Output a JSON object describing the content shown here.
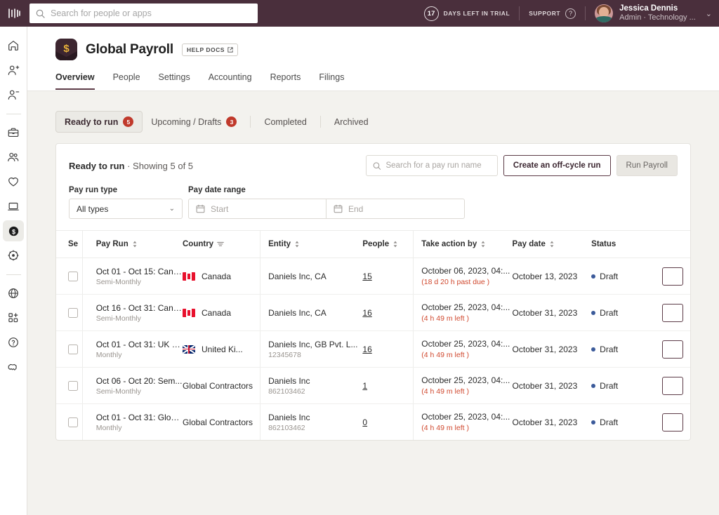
{
  "topbar": {
    "logo_name": "rippling-logo",
    "search": {
      "placeholder": "Search for people or apps",
      "value": ""
    },
    "trial_days": "17",
    "trial_label": "DAYS LEFT IN TRIAL",
    "support_label": "SUPPORT",
    "help_icon": "?",
    "user_name": "Jessica Dennis",
    "user_role": "Admin · Technology ...",
    "caret": "⌄"
  },
  "rail": {
    "items": [
      {
        "icon": "home-icon",
        "active": false
      },
      {
        "icon": "user-add-icon",
        "active": false
      },
      {
        "icon": "user-remove-icon",
        "active": false
      },
      {
        "icon": "briefcase-icon",
        "active": false
      },
      {
        "icon": "people-icon",
        "active": false
      },
      {
        "icon": "heart-icon",
        "active": false
      },
      {
        "icon": "laptop-icon",
        "active": false
      },
      {
        "icon": "dollar-circle-icon",
        "active": true
      },
      {
        "icon": "gear-icon",
        "active": false
      },
      {
        "icon": "globe-icon",
        "active": false
      },
      {
        "icon": "apps-add-icon",
        "active": false
      },
      {
        "icon": "question-circle-icon",
        "active": false
      },
      {
        "icon": "handshake-icon",
        "active": false
      }
    ]
  },
  "page": {
    "app_icon": "payroll-dollar-icon",
    "title": "Global Payroll",
    "help_docs_label": "HELP DOCS",
    "help_docs_icon": "external-link-icon",
    "nav_tabs": [
      {
        "label": "Overview",
        "active": true
      },
      {
        "label": "People",
        "active": false
      },
      {
        "label": "Settings",
        "active": false
      },
      {
        "label": "Accounting",
        "active": false
      },
      {
        "label": "Reports",
        "active": false
      },
      {
        "label": "Filings",
        "active": false
      }
    ]
  },
  "status_tabs": [
    {
      "label": "Ready to run",
      "badge": "5",
      "selected": true
    },
    {
      "label": "Upcoming / Drafts",
      "badge": "3",
      "selected": false
    },
    {
      "label": "Completed",
      "badge": "",
      "selected": false
    },
    {
      "label": "Archived",
      "badge": "",
      "selected": false
    }
  ],
  "card": {
    "title_bold": "Ready to run",
    "title_rest": " · Showing 5 of 5",
    "search": {
      "placeholder": "Search for a pay run name",
      "value": ""
    },
    "offcycle_button": "Create an off-cycle run",
    "run_payroll_button": "Run Payroll"
  },
  "filters": {
    "pay_run_type_label": "Pay run type",
    "pay_run_type_value": "All types",
    "pay_date_range_label": "Pay date range",
    "start_placeholder": "Start",
    "end_placeholder": "End"
  },
  "table": {
    "columns": [
      {
        "label": "Se",
        "sort": false,
        "filter": false
      },
      {
        "label": "Pay Run",
        "sort": true,
        "filter": false
      },
      {
        "label": "Country",
        "sort": false,
        "filter": true
      },
      {
        "label": "Entity",
        "sort": true,
        "filter": false
      },
      {
        "label": "People",
        "sort": true,
        "filter": false
      },
      {
        "label": "Take action by",
        "sort": true,
        "filter": false
      },
      {
        "label": "Pay date",
        "sort": true,
        "filter": false
      },
      {
        "label": "Status",
        "sort": false,
        "filter": false
      }
    ],
    "rows": [
      {
        "checked": false,
        "pay_run": "Oct 01 - Oct 15: Cana...",
        "pay_run_sub": "Semi-Monthly",
        "country": "Canada",
        "flag": "flag-ca",
        "entity": "Daniels Inc, CA",
        "entity_sub": "",
        "people": "15",
        "take_action_by": "October 06, 2023, 04:...",
        "take_action_sub": "(18 d 20 h past due )",
        "pay_date": "October 13, 2023",
        "status": "Draft"
      },
      {
        "checked": false,
        "pay_run": "Oct 16 - Oct 31: Cana...",
        "pay_run_sub": "Semi-Monthly",
        "country": "Canada",
        "flag": "flag-ca",
        "entity": "Daniels Inc, CA",
        "entity_sub": "",
        "people": "16",
        "take_action_by": "October 25, 2023, 04:...",
        "take_action_sub": "(4 h 49 m left )",
        "pay_date": "October 31, 2023",
        "status": "Draft"
      },
      {
        "checked": false,
        "pay_run": "Oct 01 - Oct 31: UK D...",
        "pay_run_sub": "Monthly",
        "country": "United Ki...",
        "flag": "flag-gb",
        "entity": "Daniels Inc, GB Pvt. L...",
        "entity_sub": "12345678",
        "people": "16",
        "take_action_by": "October 25, 2023, 04:...",
        "take_action_sub": "(4 h 49 m left )",
        "pay_date": "October 31, 2023",
        "status": "Draft"
      },
      {
        "checked": false,
        "pay_run": "Oct 06 - Oct 20: Sem...",
        "pay_run_sub": "Semi-Monthly",
        "country": "Global Contractors",
        "flag": "",
        "entity": "Daniels Inc",
        "entity_sub": "862103462",
        "people": "1",
        "take_action_by": "October 25, 2023, 04:...",
        "take_action_sub": "(4 h 49 m left )",
        "pay_date": "October 31, 2023",
        "status": "Draft"
      },
      {
        "checked": false,
        "pay_run": "Oct 01 - Oct 31: Glob...",
        "pay_run_sub": "Monthly",
        "country": "Global Contractors",
        "flag": "",
        "entity": "Daniels Inc",
        "entity_sub": "862103462",
        "people": "0",
        "take_action_by": "October 25, 2023, 04:...",
        "take_action_sub": "(4 h 49 m left )",
        "pay_date": "October 31, 2023",
        "status": "Draft"
      }
    ]
  },
  "colors": {
    "topbar": "#4a2f3c",
    "accent": "#5c3b47",
    "badge": "#c0392b",
    "danger_text": "#d0492f",
    "status_dot": "#3b5a9a",
    "page_bg": "#f3f2ee"
  }
}
